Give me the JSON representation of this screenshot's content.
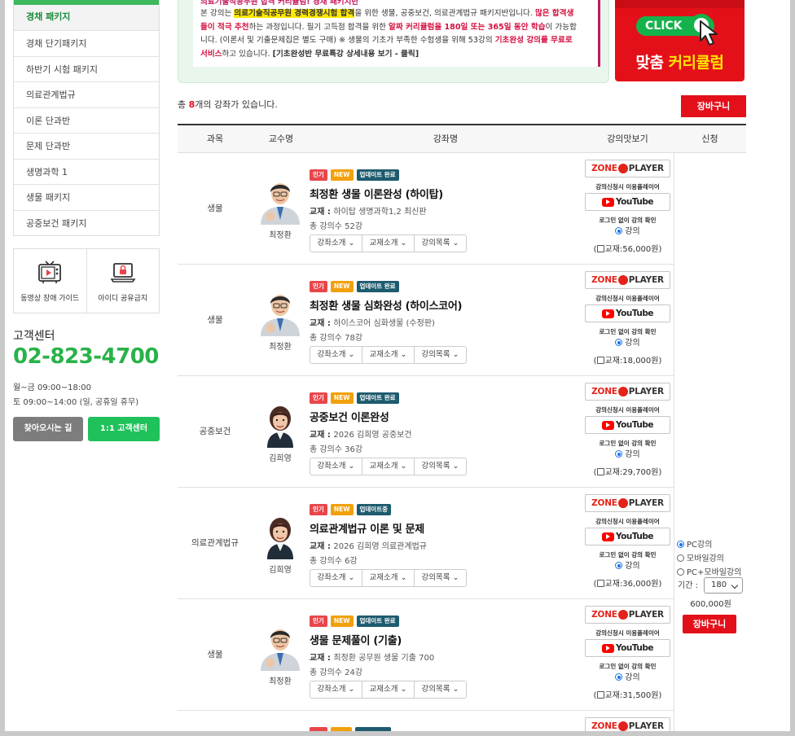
{
  "sidebar": {
    "items": [
      {
        "label": "경채 패키지"
      },
      {
        "label": "경채 단기패키지"
      },
      {
        "label": "하반기 시험 패키지"
      },
      {
        "label": "의료관계법규"
      },
      {
        "label": "이론 단과반"
      },
      {
        "label": "문제 단과반"
      },
      {
        "label": "생명과학 1"
      },
      {
        "label": "생물 패키지"
      },
      {
        "label": "공중보건 패키지"
      }
    ],
    "quick": [
      {
        "label": "동영상 장애 가이드",
        "icon": "tv-play-icon"
      },
      {
        "label": "아이디 공유금지",
        "icon": "locked-laptop-icon"
      }
    ],
    "cs": {
      "title": "고객센터",
      "phone": "02-823-4700",
      "hours1": "월~금 09:00~18:00",
      "hours2": "토 09:00~14:00 (일, 공휴일 휴무)",
      "btn_map": "찾아오시는 길",
      "btn_qna": "1:1 고객센터"
    }
  },
  "banner": {
    "line0": "의료기술직공무원 합격 커리큘럼! 경채 패키지반",
    "l1a": "본 강의는 ",
    "l1b": "의료기술직공무원 경력경쟁시험 합격",
    "l1c": "을 위한 생물, 공중보건, 의료관계법규 패키지반입니다. ",
    "l1d": "많은 합격생",
    "l2a": "들이 적극 추천",
    "l2b": "하는 과정입니다. 필기 고득점 합격을 위한 ",
    "l2c": "알짜 커리큘럼을 180일 또는 365일 동안 학습",
    "l2d": "이 가능합",
    "l3a": "니다. (이론서 및 기출문제집은 별도 구매) ※ 생물의 기초가 부족한 수험생을 위해 53강의 ",
    "l3b": "기초완성 강의를 무료로",
    "l4a": "서비스",
    "l4b": "하고 있습니다. ",
    "l4c": "[기초완성반 무료특강 상세내용 보기 - 클릭]"
  },
  "promo": {
    "click": "CLICK",
    "text1": "맞춤 ",
    "text2": "커리큘럼"
  },
  "list": {
    "count_prefix": "총 ",
    "count": "8",
    "count_suffix": "개의 강좌가 있습니다.",
    "cart_label": "장바구니"
  },
  "table": {
    "headers": [
      "과목",
      "교수명",
      "강좌명",
      "강의맛보기",
      "신청"
    ]
  },
  "labels": {
    "zone1": "ZONE",
    "zone2": "PLAYER",
    "player_note": "강의신청시 이용플레이어",
    "youtube": "YouTube",
    "login_note": "로그인 없이 강의 확인",
    "lecture_radio": "강의",
    "sel_intro": "강좌소개",
    "sel_book": "교재소개",
    "sel_list": "강의목록"
  },
  "courses": [
    {
      "subject": "생물",
      "professor": "최정환",
      "badges": [
        "인기",
        "NEW",
        "업데이트 완료"
      ],
      "title": "최정환 생물 이론완성 (하이탑)",
      "book_label": "교재 : ",
      "book": "하이탑 생명과학1,2 최신판",
      "lectures": "총 강의수 52강",
      "book_price": "교재:56,000원"
    },
    {
      "subject": "생물",
      "professor": "최정환",
      "badges": [
        "인기",
        "NEW",
        "업데이트 완료"
      ],
      "title": "최정환 생물 심화완성 (하이스코어)",
      "book_label": "교재 : ",
      "book": "하이스코어 심화생물 (수정판)",
      "lectures": "총 강의수 78강",
      "book_price": "교재:18,000원"
    },
    {
      "subject": "공중보건",
      "professor": "김희영",
      "badges": [
        "인기",
        "NEW",
        "업데이트 완료"
      ],
      "title": "공중보건 이론완성",
      "book_label": "교재 : ",
      "book": "2026 김희영 공중보건",
      "lectures": "총 강의수 36강",
      "book_price": "교재:29,700원"
    },
    {
      "subject": "의료관계법규",
      "professor": "김희영",
      "badges": [
        "인기",
        "NEW",
        "업데이트중"
      ],
      "title": "의료관계법규 이론 및 문제",
      "book_label": "교재 : ",
      "book": "2026 김희영 의료관계법규",
      "lectures": "총 강의수 6강",
      "book_price": "교재:36,000원"
    },
    {
      "subject": "생물",
      "professor": "최정환",
      "badges": [
        "인기",
        "NEW",
        "업데이트 완료"
      ],
      "title": "생물 문제풀이 (기출)",
      "book_label": "교재 : ",
      "book": "최정환 공무원 생물 기출 700",
      "lectures": "총 강의수 24강",
      "book_price": "교재:31,500원"
    }
  ],
  "apply": {
    "options": [
      "PC강의",
      "모바일강의",
      "PC+모바일강의"
    ],
    "period_label": "기간 :",
    "period_value": "180",
    "price": "600,000원",
    "cart_label": "장바구니"
  },
  "colors": {
    "brand_green": "#29b24a",
    "accent_red": "#e3101a"
  }
}
